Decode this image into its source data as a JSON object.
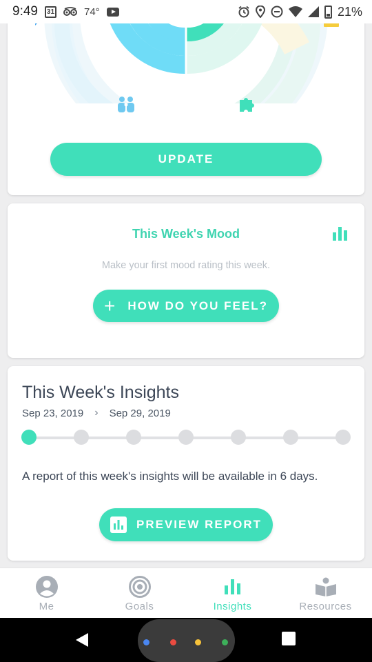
{
  "status_bar": {
    "time": "9:49",
    "calendar_day": "31",
    "temperature": "74°",
    "battery_percent": "21%",
    "icons": [
      "calendar-icon",
      "tripadvisor-icon",
      "youtube-icon",
      "alarm-icon",
      "location-icon",
      "dnd-icon",
      "wifi-icon",
      "signal-icon",
      "battery-icon"
    ]
  },
  "wheel_card": {
    "icons": [
      "chat-icon",
      "people-icon",
      "puzzle-icon",
      "yellow-tag-icon"
    ],
    "update_label": "UPDATE"
  },
  "mood_card": {
    "title": "This Week's Mood",
    "subtitle": "Make your first mood rating this week.",
    "button_label": "HOW DO YOU FEEL?"
  },
  "insights_card": {
    "title": "This Week's Insights",
    "date_start": "Sep 23, 2019",
    "date_separator": "›",
    "date_end": "Sep 29, 2019",
    "progress": {
      "completed_days": 1,
      "total_days": 7
    },
    "message": "A report of this week's insights will be available in 6 days.",
    "button_label": "PREVIEW REPORT"
  },
  "bottom_nav": {
    "items": [
      {
        "label": "Me",
        "icon": "person-icon"
      },
      {
        "label": "Goals",
        "icon": "target-icon"
      },
      {
        "label": "Insights",
        "icon": "bar-chart-icon",
        "active": true
      },
      {
        "label": "Resources",
        "icon": "book-icon"
      }
    ]
  },
  "colors": {
    "accent": "#40dfba",
    "accent_text": "#3fd4b0",
    "wheel_blue": "#6fdcf7",
    "wheel_teal": "#40dfba",
    "muted": "#a8aeb6"
  }
}
